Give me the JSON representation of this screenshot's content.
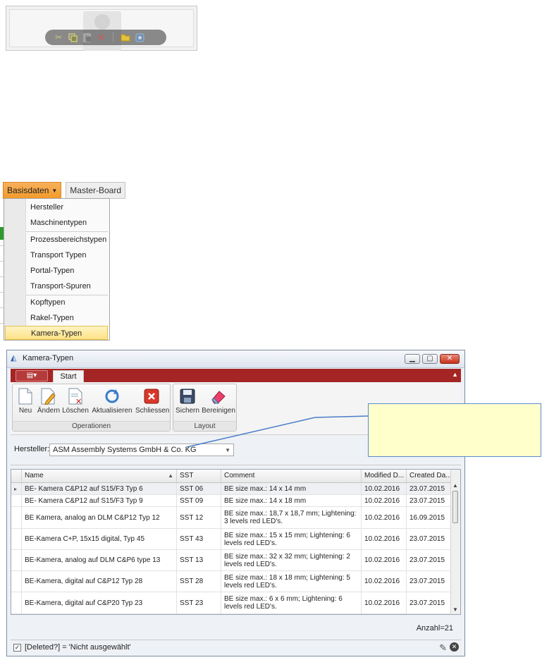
{
  "menu": {
    "tab_active": "Basisdaten",
    "tab_other": "Master-Board",
    "items": [
      "Hersteller",
      "Maschinentypen",
      "Prozessbereichstypen",
      "Transport Typen",
      "Portal-Typen",
      "Transport-Spuren",
      "Kopftypen",
      "Rakel-Typen",
      "Kamera-Typen"
    ],
    "selected_item": "Kamera-Typen"
  },
  "window": {
    "title": "Kamera-Typen",
    "ribbon_tab": "Start",
    "groups": {
      "operationen": {
        "title": "Operationen",
        "buttons": [
          "Neu",
          "Ändern",
          "Löschen",
          "Aktualisieren",
          "Schliessen"
        ]
      },
      "layout": {
        "title": "Layout",
        "buttons": [
          "Sichern",
          "Bereinigen"
        ]
      }
    },
    "hersteller_label": "Hersteller:",
    "hersteller_value": "ASM Assembly Systems GmbH & Co. KG",
    "grid": {
      "columns": [
        "Name",
        "SST",
        "Comment",
        "Modified D...",
        "Created Da..."
      ],
      "rows": [
        [
          "BE- Kamera C&P12 auf S15/F3 Typ 6",
          "SST 06",
          "BE size max.: 14 x 14 mm",
          "10.02.2016",
          "23.07.2015"
        ],
        [
          "BE- Kamera C&P12 auf S15/F3 Typ 9",
          "SST 09",
          "BE size max.: 14 x 18 mm",
          "10.02.2016",
          "23.07.2015"
        ],
        [
          "BE Kamera, analog an DLM C&P12 Typ 12",
          "SST 12",
          "BE size max.: 18,7 x 18,7 mm; Lightening: 3 levels red LED's.",
          "10.02.2016",
          "16.09.2015"
        ],
        [
          "BE-Kamera C+P, 15x15 digital, Typ 45",
          "SST 43",
          "BE size max.: 15 x 15 mm; Lightening: 6 levels red LED's.",
          "10.02.2016",
          "23.07.2015"
        ],
        [
          "BE-Kamera, analog auf DLM C&P6 type 13",
          "SST 13",
          "BE size max.: 32 x 32 mm; Lightening: 2 levels red LED's.",
          "10.02.2016",
          "23.07.2015"
        ],
        [
          "BE-Kamera, digital auf C&P12 Typ 28",
          "SST 28",
          "BE size max.: 18 x 18 mm; Lightening: 5 levels red LED's.",
          "10.02.2016",
          "23.07.2015"
        ],
        [
          "BE-Kamera, digital auf C&P20 Typ 23",
          "SST 23",
          "BE size max.: 6 x 6 mm; Lightening: 6 levels red LED's.",
          "10.02.2016",
          "23.07.2015"
        ]
      ]
    },
    "count": "Anzahl=21",
    "filter_text": "[Deleted?] = 'Nicht ausgewählt'",
    "filter_checked": "✓"
  },
  "colors": {
    "ribbon_red": "#a52424",
    "menu_orange": "#f39a2b",
    "callout_fill": "#ffffcc",
    "callout_border": "#5b8bd1"
  },
  "icons": {
    "toolbar": [
      "cut-icon",
      "copy-icon",
      "paste-icon",
      "delete-icon",
      "folder-icon",
      "settings-icon"
    ]
  }
}
